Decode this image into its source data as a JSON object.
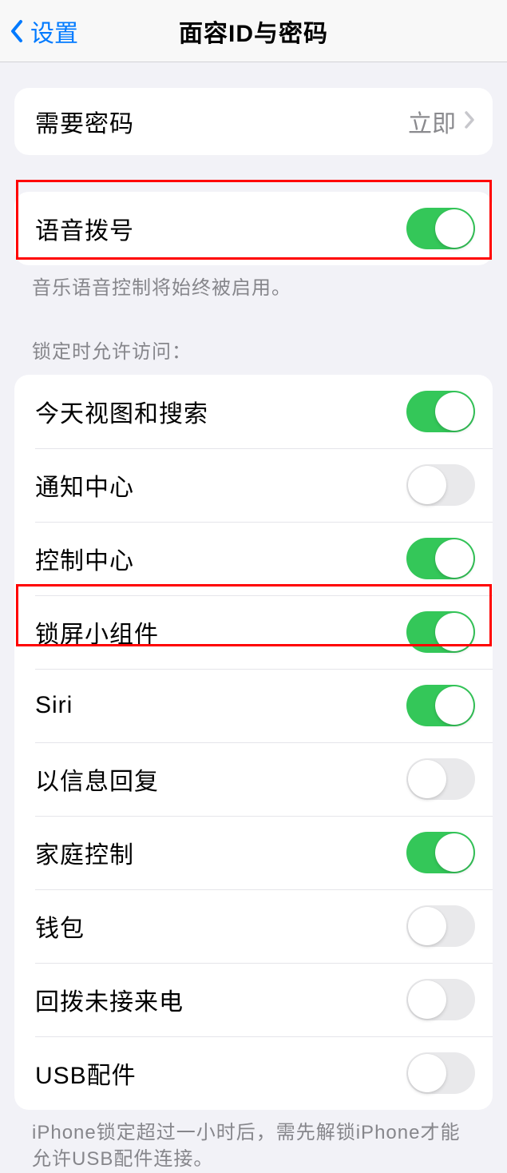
{
  "header": {
    "back_label": "设置",
    "title": "面容ID与密码"
  },
  "group_passcode": {
    "require_passcode_label": "需要密码",
    "require_passcode_value": "立即"
  },
  "group_voice": {
    "voice_dial_label": "语音拨号",
    "voice_dial_on": true,
    "voice_dial_caption": "音乐语音控制将始终被启用。"
  },
  "section_lock_header": "锁定时允许访问：",
  "lock_items": [
    {
      "label": "今天视图和搜索",
      "on": true
    },
    {
      "label": "通知中心",
      "on": false
    },
    {
      "label": "控制中心",
      "on": true
    },
    {
      "label": "锁屏小组件",
      "on": true
    },
    {
      "label": "Siri",
      "on": true
    },
    {
      "label": "以信息回复",
      "on": false
    },
    {
      "label": "家庭控制",
      "on": true
    },
    {
      "label": "钱包",
      "on": false
    },
    {
      "label": "回拨未接来电",
      "on": false
    },
    {
      "label": "USB配件",
      "on": false
    }
  ],
  "footer_caption": "iPhone锁定超过一小时后，需先解锁iPhone才能允许USB配件连接。"
}
